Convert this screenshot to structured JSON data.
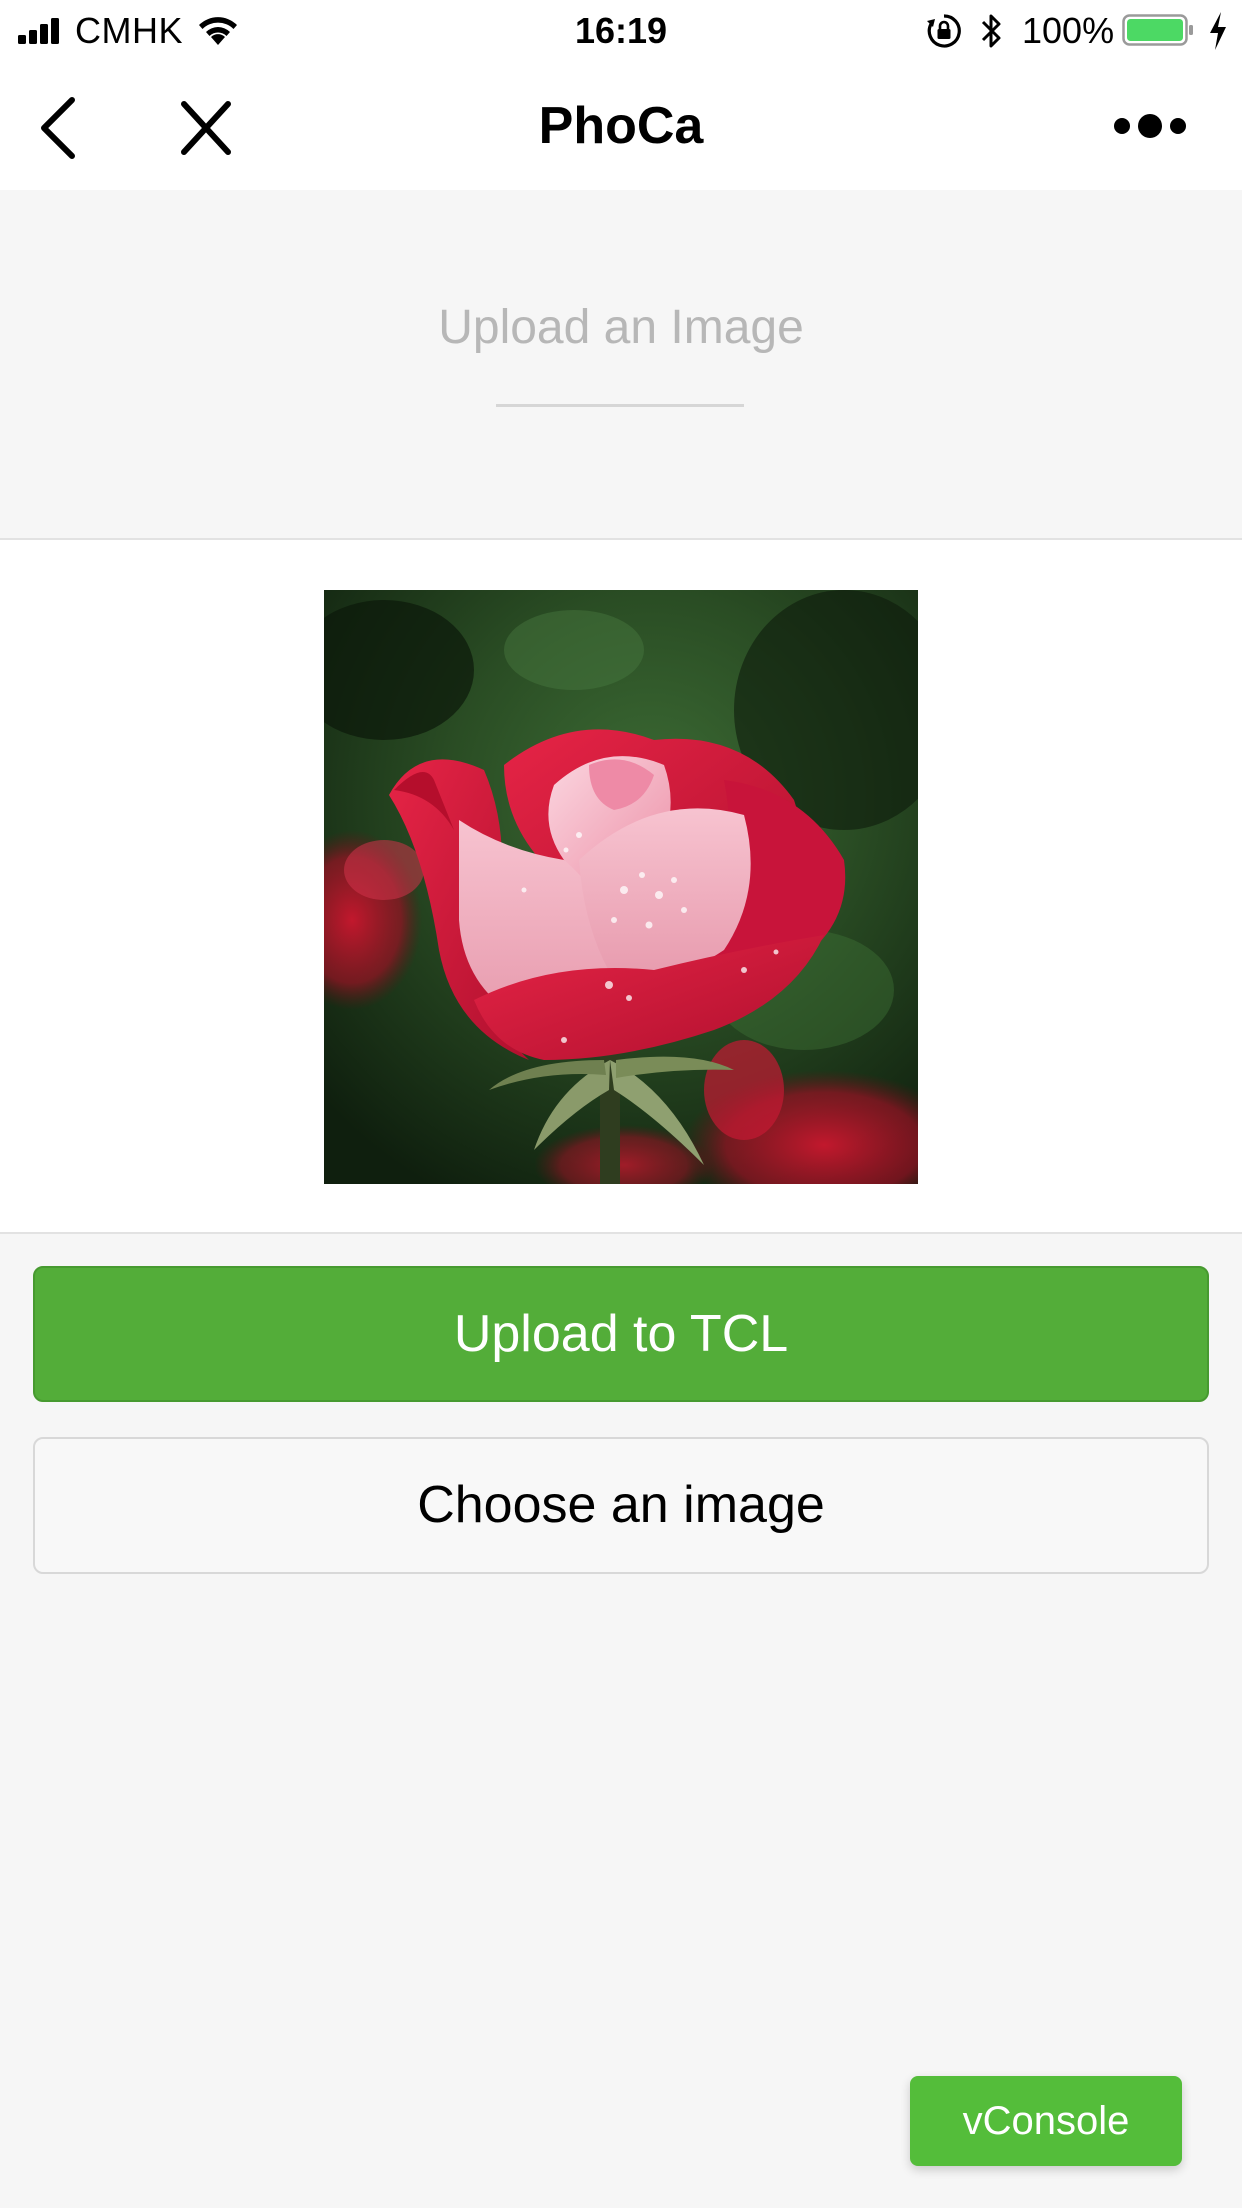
{
  "status_bar": {
    "carrier": "CMHK",
    "time": "16:19",
    "battery_percent": "100%",
    "icons": [
      "signal-icon",
      "wifi-icon",
      "orientation-lock-icon",
      "bluetooth-icon",
      "battery-icon",
      "charging-icon"
    ]
  },
  "nav": {
    "title": "PhoCa",
    "icons": [
      "back-icon",
      "close-icon",
      "more-icon"
    ]
  },
  "upload_header": {
    "title": "Upload an Image"
  },
  "preview": {
    "image": "red-rose-photo"
  },
  "buttons": {
    "upload_label": "Upload to TCL",
    "choose_label": "Choose an image",
    "vconsole_label": "vConsole"
  },
  "colors": {
    "primary_green": "#53ad39",
    "vconsole_green": "#54bd3a",
    "background": "#f6f6f6",
    "placeholder_text": "#b7b7b7"
  }
}
